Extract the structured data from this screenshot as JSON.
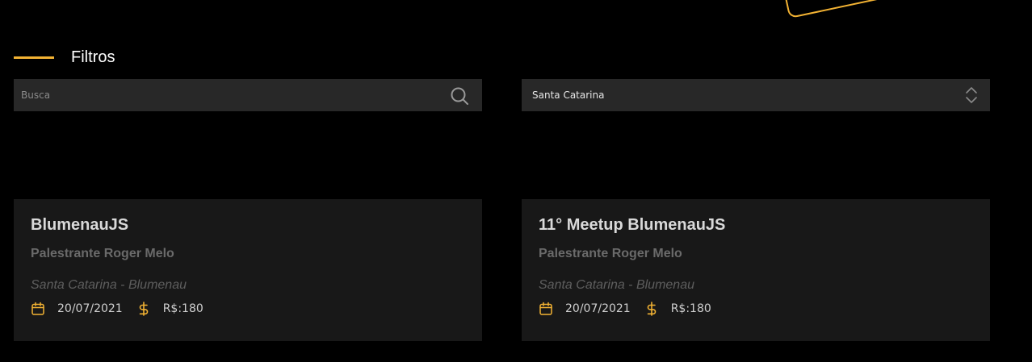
{
  "colors": {
    "background": "#000000",
    "accent": "#f2b233",
    "input_bg": "#282828",
    "card_bg": "#181818"
  },
  "filters": {
    "heading": "Filtros",
    "search": {
      "placeholder": "Busca",
      "value": "",
      "icon": "search-icon"
    },
    "state_select": {
      "selected": "Santa Catarina",
      "icon": "chevron-up-down-icon"
    }
  },
  "events": [
    {
      "title": "BlumenauJS",
      "speaker": "Palestrante Roger Melo",
      "location": "Santa Catarina - Blumenau",
      "date": "20/07/2021",
      "price": "R$:180",
      "date_icon": "calendar-icon",
      "price_icon": "dollar-icon"
    },
    {
      "title": "11° Meetup BlumenauJS",
      "speaker": "Palestrante Roger Melo",
      "location": "Santa Catarina - Blumenau",
      "date": "20/07/2021",
      "price": "R$:180",
      "date_icon": "calendar-icon",
      "price_icon": "dollar-icon"
    }
  ]
}
